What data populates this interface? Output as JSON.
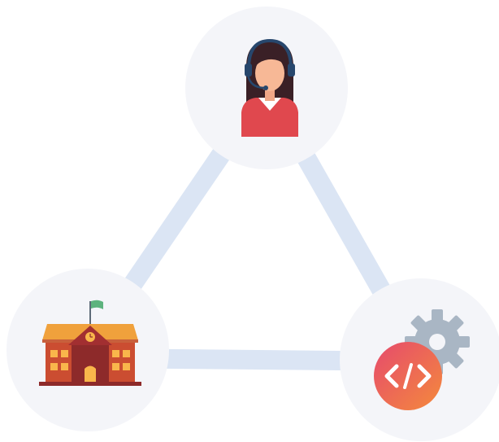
{
  "diagram": {
    "connector_color": "#dbe5f4",
    "node_fill": "#f4f5f9",
    "nodes": [
      {
        "id": "support-agent",
        "icon": "customer-support-headset-icon"
      },
      {
        "id": "school",
        "icon": "school-building-icon"
      },
      {
        "id": "developer",
        "icon": "code-gear-icon"
      }
    ],
    "edges": [
      {
        "from": "support-agent",
        "to": "school"
      },
      {
        "from": "support-agent",
        "to": "developer"
      },
      {
        "from": "school",
        "to": "developer"
      }
    ]
  }
}
